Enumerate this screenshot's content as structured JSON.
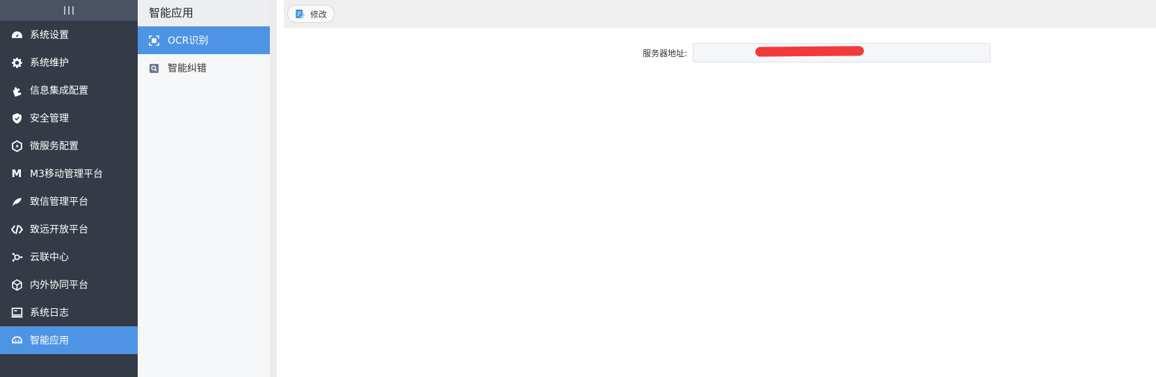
{
  "sidebar": {
    "toggle_icon": "hamburger-vertical-bars-icon",
    "items": [
      {
        "label": "系统设置",
        "icon": "dashboard-gauge-icon"
      },
      {
        "label": "系统维护",
        "icon": "gear-icon"
      },
      {
        "label": "信息集成配置",
        "icon": "puzzle-icon"
      },
      {
        "label": "安全管理",
        "icon": "shield-icon"
      },
      {
        "label": "微服务配置",
        "icon": "hexagon-icon"
      },
      {
        "label": "M3移动管理平台",
        "icon": "m-logo-icon"
      },
      {
        "label": "致信管理平台",
        "icon": "leaf-icon"
      },
      {
        "label": "致远开放平台",
        "icon": "code-slash-icon"
      },
      {
        "label": "云联中心",
        "icon": "cloud-connect-icon"
      },
      {
        "label": "内外协同平台",
        "icon": "cube-network-icon"
      },
      {
        "label": "系统日志",
        "icon": "monitor-icon"
      },
      {
        "label": "智能应用",
        "icon": "robot-icon"
      }
    ],
    "active_index": 11
  },
  "subpanel": {
    "title": "智能应用",
    "items": [
      {
        "label": "OCR识别",
        "icon": "scan-icon"
      },
      {
        "label": "智能纠错",
        "icon": "magnifier-icon"
      }
    ],
    "active_index": 0
  },
  "toolbar": {
    "edit_label": "修改",
    "edit_icon": "edit-document-icon"
  },
  "form": {
    "server_label": "服务器地址:",
    "server_value": ""
  },
  "colors": {
    "sidebar_bg": "#343a46",
    "accent": "#4d94e4",
    "redaction": "#f23a3a"
  }
}
